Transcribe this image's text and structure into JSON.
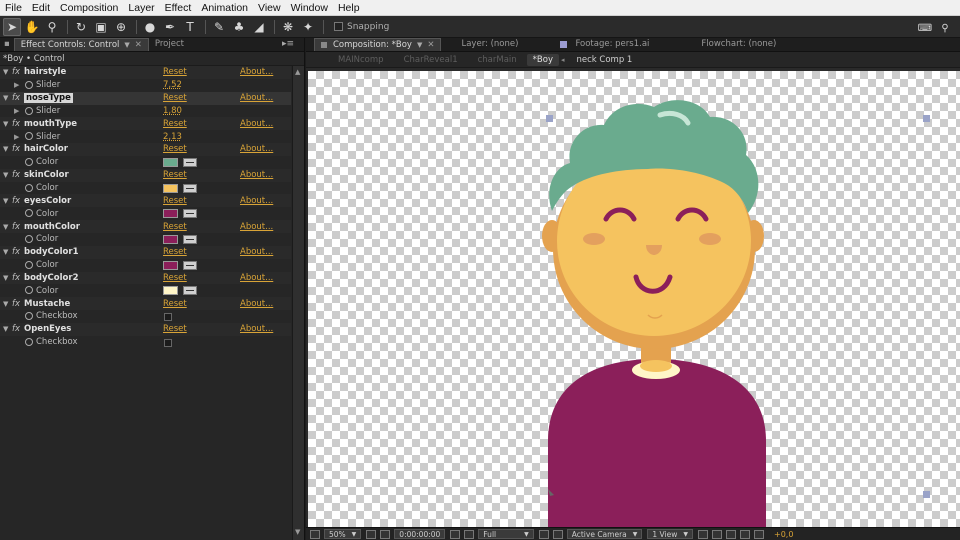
{
  "menu": [
    "File",
    "Edit",
    "Composition",
    "Layer",
    "Effect",
    "Animation",
    "View",
    "Window",
    "Help"
  ],
  "toolbar": {
    "tools": [
      {
        "icon": "selection-arrow-icon",
        "glyph": "➤",
        "active": true
      },
      {
        "icon": "hand-icon",
        "glyph": "✋",
        "active": false
      },
      {
        "icon": "zoom-icon",
        "glyph": "⚲",
        "active": false
      },
      {
        "icon": "rotate-icon",
        "glyph": "↻",
        "active": false
      },
      {
        "icon": "camera-icon",
        "glyph": "▣",
        "active": false
      },
      {
        "icon": "pan-behind-icon",
        "glyph": "⊕",
        "active": false
      },
      {
        "icon": "ellipse-icon",
        "glyph": "●",
        "active": false
      },
      {
        "icon": "pen-icon",
        "glyph": "✒",
        "active": false
      },
      {
        "icon": "type-icon",
        "glyph": "T",
        "active": false
      },
      {
        "icon": "brush-icon",
        "glyph": "✎",
        "active": false
      },
      {
        "icon": "clone-stamp-icon",
        "glyph": "♣",
        "active": false
      },
      {
        "icon": "eraser-icon",
        "glyph": "◢",
        "active": false
      },
      {
        "icon": "roto-brush-icon",
        "glyph": "❋",
        "active": false
      },
      {
        "icon": "puppet-pin-icon",
        "glyph": "✦",
        "active": false
      }
    ],
    "snapping_label": "Snapping"
  },
  "left_panel": {
    "tab_effect_controls": "Effect Controls: Control",
    "tab_project": "Project",
    "layer_title": "*Boy • Control",
    "effects": [
      {
        "name": "hairstyle",
        "reset": "Reset",
        "about": "About...",
        "sub": "Slider",
        "kind": "slider",
        "value": "7,52"
      },
      {
        "name": "noseType",
        "reset": "Reset",
        "about": "About...",
        "sub": "Slider",
        "kind": "slider",
        "value": "1,80",
        "selected": true
      },
      {
        "name": "mouthType",
        "reset": "Reset",
        "about": "About...",
        "sub": "Slider",
        "kind": "slider",
        "value": "2,13"
      },
      {
        "name": "hairColor",
        "reset": "Reset",
        "about": "About...",
        "sub": "Color",
        "kind": "color",
        "color": "#6aab8e"
      },
      {
        "name": "skinColor",
        "reset": "Reset",
        "about": "About...",
        "sub": "Color",
        "kind": "color",
        "color": "#f5c35f"
      },
      {
        "name": "eyesColor",
        "reset": "Reset",
        "about": "About...",
        "sub": "Color",
        "kind": "color",
        "color": "#8b1f5a"
      },
      {
        "name": "mouthColor",
        "reset": "Reset",
        "about": "About...",
        "sub": "Color",
        "kind": "color",
        "color": "#8b1f5a"
      },
      {
        "name": "bodyColor1",
        "reset": "Reset",
        "about": "About...",
        "sub": "Color",
        "kind": "color",
        "color": "#8b1f5a"
      },
      {
        "name": "bodyColor2",
        "reset": "Reset",
        "about": "About...",
        "sub": "Color",
        "kind": "color",
        "color": "#fff6c8"
      },
      {
        "name": "Mustache",
        "reset": "Reset",
        "about": "About...",
        "sub": "Checkbox",
        "kind": "checkbox"
      },
      {
        "name": "OpenEyes",
        "reset": "Reset",
        "about": "About...",
        "sub": "Checkbox",
        "kind": "checkbox"
      }
    ]
  },
  "comp_panel": {
    "tab_composition": "Composition: *Boy",
    "tab_layer": "Layer: (none)",
    "tab_footage": "Footage: pers1.ai",
    "tab_flowchart": "Flowchart: (none)",
    "breadcrumbs": [
      "MAINcomp",
      "CharReveal1",
      "charMain",
      "*Boy",
      "neck Comp 1"
    ],
    "active_breadcrumb": "*Boy",
    "footer": {
      "zoom": "50%",
      "timecode": "0:00:00:00",
      "resolution": "Full",
      "camera": "Active Camera",
      "views": "1 View",
      "exposure": "+0,0"
    }
  },
  "colors": {
    "hair": "#6aab8e",
    "hair_highlight": "#c7e6d6",
    "skin": "#f5c35f",
    "skin_shadow": "#e4a24f",
    "ear": "#e4a24f",
    "cheek": "#e3a05e",
    "features": "#8b1f5a",
    "nose": "#e3a05e",
    "neck": "#e4a24f",
    "collar": "#fff6c8",
    "body": "#8b1f5a",
    "accent": "#d9a437"
  }
}
